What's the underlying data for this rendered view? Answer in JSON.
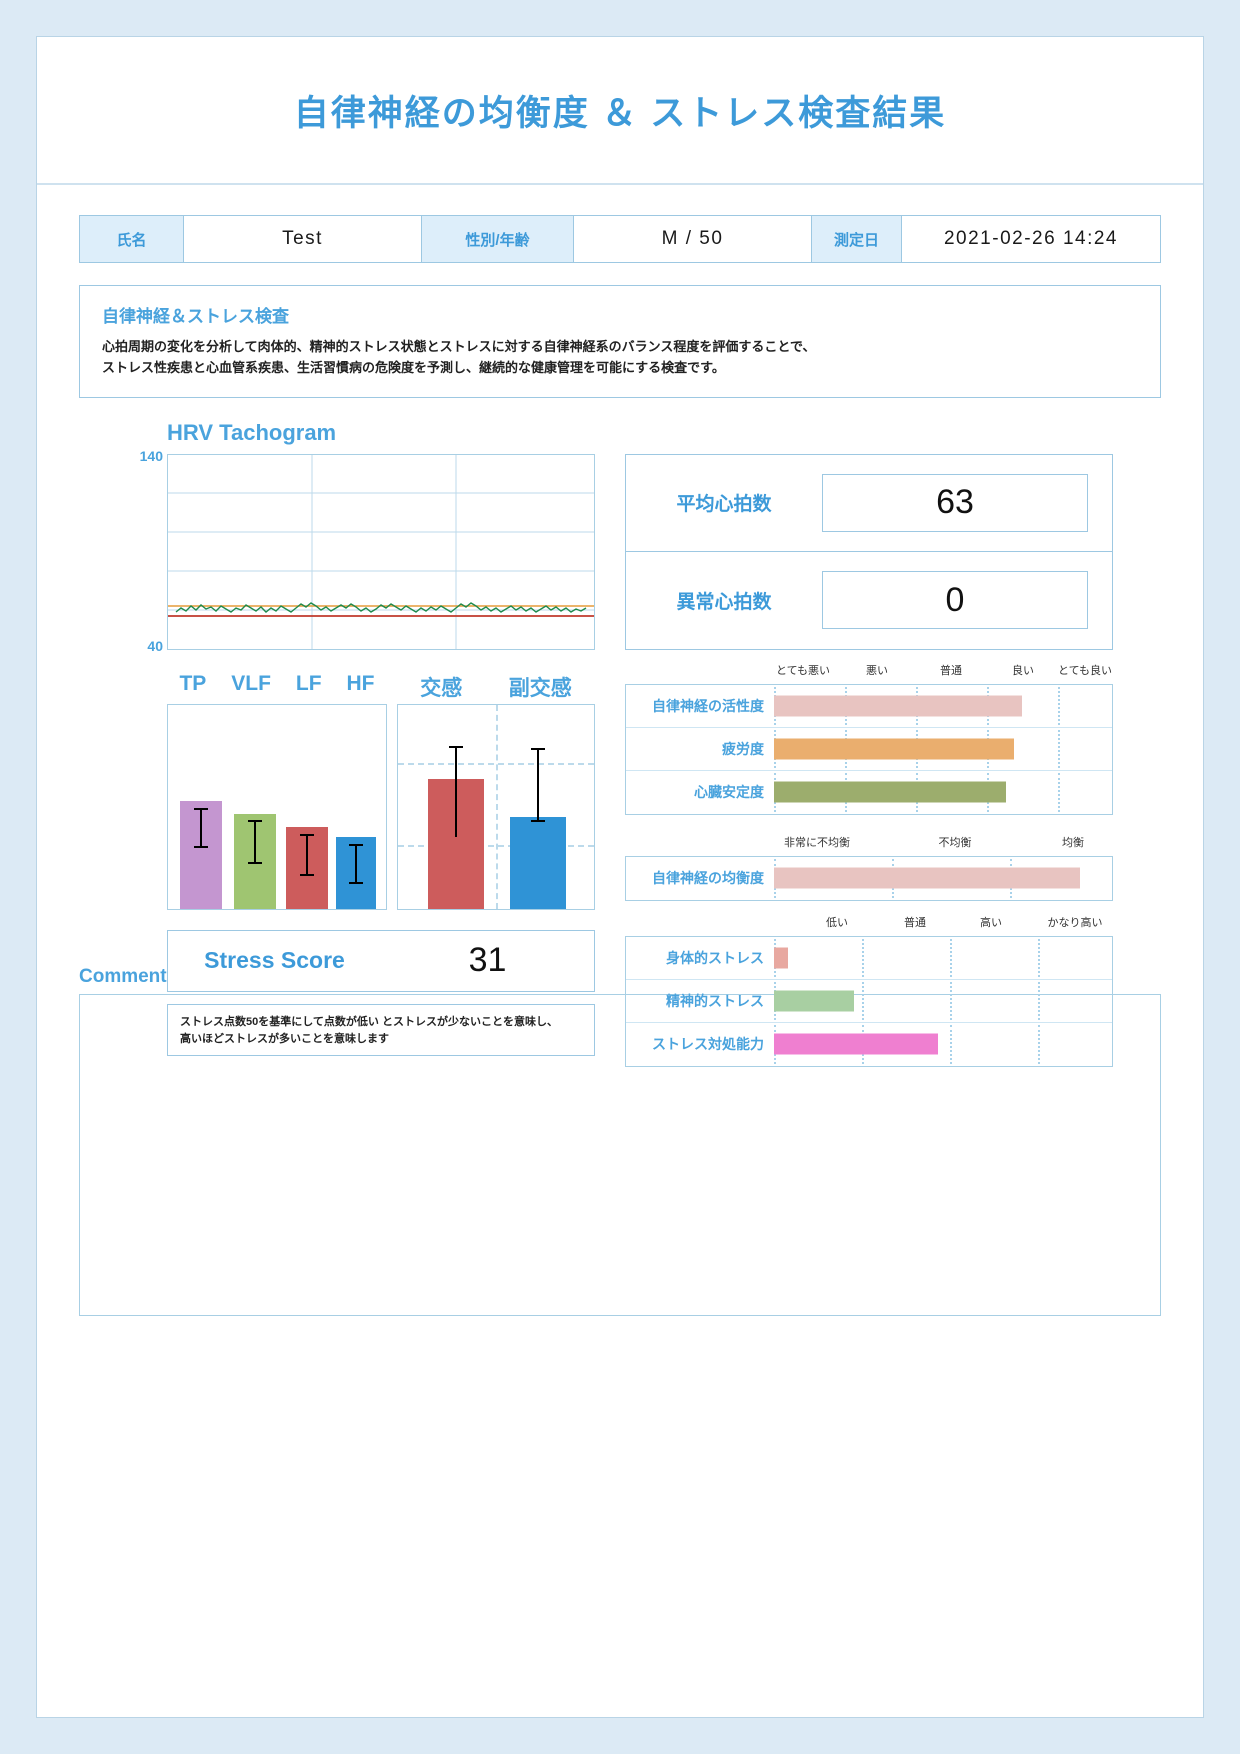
{
  "report": {
    "title": "自律神経の均衡度 ＆ ストレス検査結果"
  },
  "patient": {
    "name_label": "氏名",
    "name_value": "Test",
    "sex_age_label": "性別/年齢",
    "sex_age_value": "M / 50",
    "date_label": "測定日",
    "date_value": "2021-02-26 14:24"
  },
  "description": {
    "heading": "自律神経＆ストレス検査",
    "line1": "心拍周期の変化を分析して肉体的、精神的ストレス状態とストレスに対する自律神経系のバランス程度を評価することで、",
    "line2": "ストレス性疾患と心血管系疾患、生活習慣病の危険度を予測し、継続的な健康管理を可能にする検査です。"
  },
  "hrv": {
    "title": "HRV Tachogram",
    "axis_max": "140",
    "axis_min": "40"
  },
  "vitals": {
    "avg_hr_label": "平均心拍数",
    "avg_hr_value": "63",
    "abnormal_beats_label": "異常心拍数",
    "abnormal_beats_value": "0"
  },
  "frequency_chart": {
    "labels": [
      "TP",
      "VLF",
      "LF",
      "HF"
    ]
  },
  "ans_chart": {
    "labels": [
      "交感",
      "副交感"
    ]
  },
  "stress": {
    "score_label": "Stress Score",
    "score_value": "31",
    "note_line1": "ストレス点数50を基準にして点数が低い とストレスが少ないことを意味し、",
    "note_line2": "高いほどストレスが多いことを意味します"
  },
  "indicators_health": {
    "scale": [
      "とても悪い",
      "悪い",
      "普通",
      "良い",
      "とても良い"
    ],
    "rows": [
      {
        "label": "自律神経の活性度",
        "color": "#e8c4c1"
      },
      {
        "label": "疲労度",
        "color": "#eaae6e"
      },
      {
        "label": "心臓安定度",
        "color": "#9cad6d"
      }
    ]
  },
  "indicators_balance": {
    "scale": [
      "非常に不均衡",
      "不均衡",
      "均衡"
    ],
    "rows": [
      {
        "label": "自律神経の均衡度",
        "color": "#e8c4c1"
      }
    ]
  },
  "indicators_stress": {
    "scale": [
      "低い",
      "普通",
      "高い",
      "かなり高い"
    ],
    "rows": [
      {
        "label": "身体的ストレス",
        "color": "#e8a8a0"
      },
      {
        "label": "精神的ストレス",
        "color": "#a8cfa2"
      },
      {
        "label": "ストレス対処能力",
        "color": "#ef7fd0"
      }
    ]
  },
  "comment": {
    "title": "Comment",
    "text": ""
  },
  "chart_data": [
    {
      "type": "line",
      "title": "HRV Tachogram",
      "ylabel": "",
      "xlabel": "",
      "ylim": [
        40,
        140
      ],
      "grid": true,
      "series": [
        {
          "name": "heart-rate",
          "color": "#1f8a4c"
        },
        {
          "name": "upper-reference",
          "color": "#d98a2b"
        },
        {
          "name": "lower-reference",
          "color": "#c0392b"
        }
      ]
    },
    {
      "type": "bar",
      "title": "Frequency domain",
      "categories": [
        "TP",
        "VLF",
        "LF",
        "HF"
      ],
      "values": [
        52,
        46,
        40,
        35
      ],
      "colors": [
        "#c496d0",
        "#9fc571",
        "#cd5c5c",
        "#2f93d6"
      ],
      "ylim": [
        0,
        100
      ],
      "errors": [
        18,
        14,
        12,
        12
      ]
    },
    {
      "type": "bar",
      "title": "Autonomic nervous balance",
      "categories": [
        "交感",
        "副交感"
      ],
      "values": [
        58,
        38
      ],
      "colors": [
        "#cd5c5c",
        "#2f93d6"
      ],
      "ylim": [
        0,
        100
      ],
      "errors": [
        26,
        22
      ]
    },
    {
      "type": "bar",
      "title": "Health indicators",
      "categories": [
        "自律神経の活性度",
        "疲労度",
        "心臓安定度"
      ],
      "values": [
        78,
        75,
        73
      ],
      "xlabel": "とても悪い / 悪い / 普通 / 良い / とても良い",
      "xlim": [
        0,
        100
      ]
    },
    {
      "type": "bar",
      "title": "Autonomic balance",
      "categories": [
        "自律神経の均衡度"
      ],
      "values": [
        95
      ],
      "xlabel": "非常に不均衡 / 不均衡 / 均衡",
      "xlim": [
        0,
        100
      ]
    },
    {
      "type": "bar",
      "title": "Stress indicators",
      "categories": [
        "身体的ストレス",
        "精神的ストレス",
        "ストレス対処能力"
      ],
      "values": [
        5,
        28,
        58
      ],
      "xlabel": "低い / 普通 / 高い / かなり高い",
      "xlim": [
        0,
        100
      ]
    }
  ]
}
